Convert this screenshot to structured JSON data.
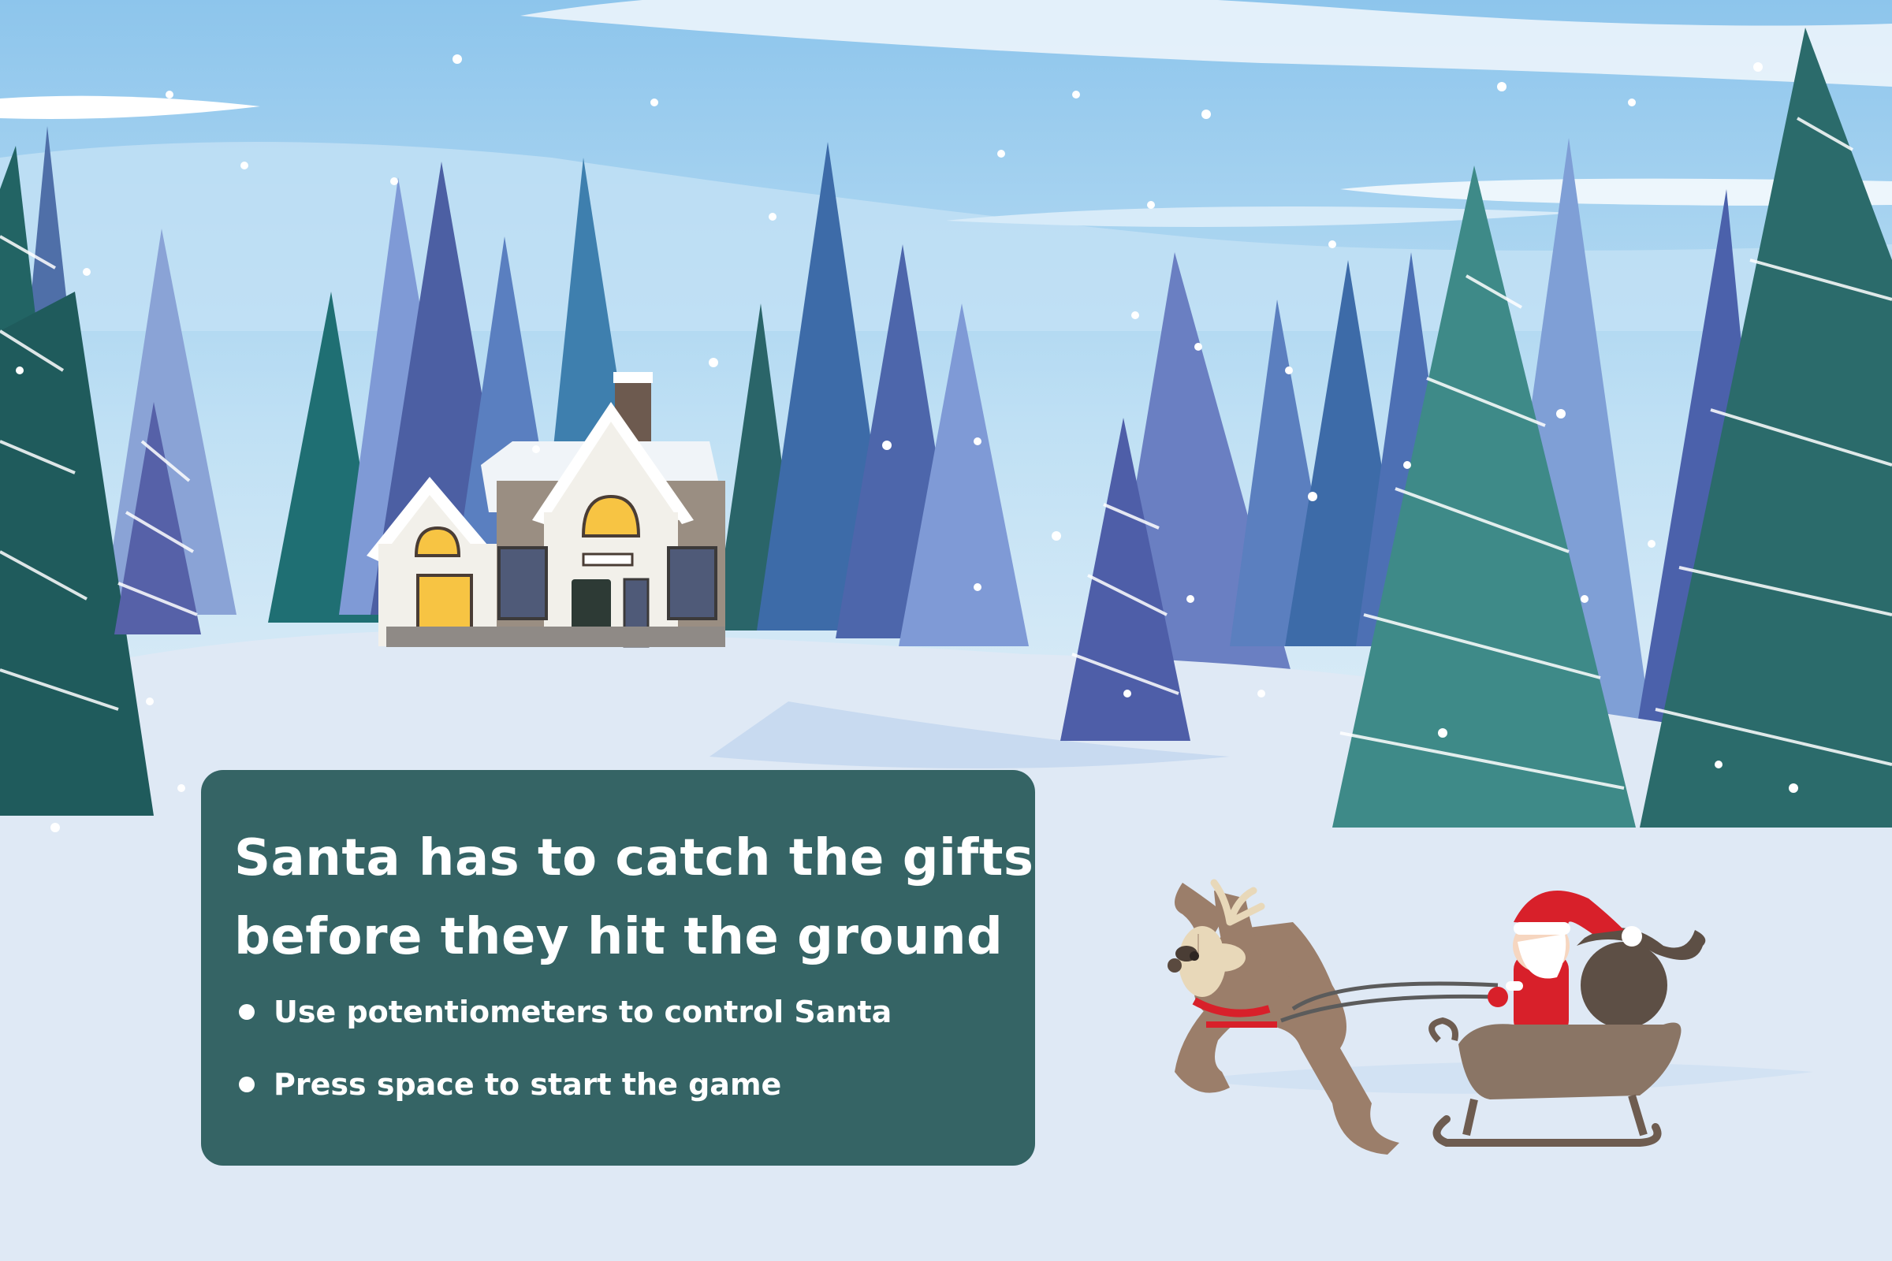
{
  "title": {
    "line1": "Santa has to catch the gifts",
    "line2": "before they hit the ground"
  },
  "instructions": [
    "Use potentiometers to control Santa",
    "Press space to start the game"
  ],
  "colors": {
    "panel": "#356465",
    "panel_text": "#ffffff",
    "sky": "#9ccdee",
    "snow": "#dfe9f5",
    "santa_red": "#d8202a",
    "reindeer_brown": "#9b7e6a",
    "sleigh_brown": "#8a7565"
  },
  "icons": {
    "bullet": "white-dot",
    "house": "snowy-house",
    "santa": "santa-sleigh",
    "reindeer": "reindeer"
  }
}
